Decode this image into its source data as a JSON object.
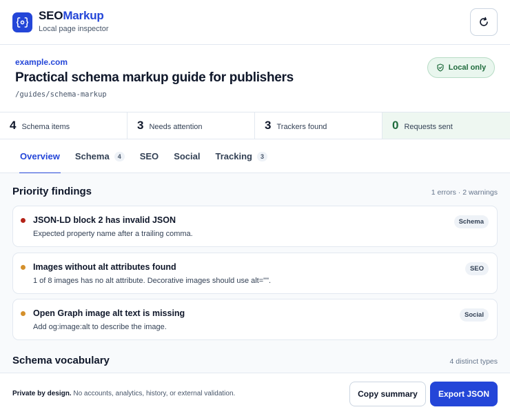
{
  "app": {
    "name_prefix": "SEO",
    "name_accent": "Markup",
    "subtitle": "Local page inspector",
    "brand_color": "#2446d8"
  },
  "header": {
    "refresh_icon": "refresh-icon"
  },
  "page": {
    "domain": "example.com",
    "title": "Practical schema markup guide for publishers",
    "path": "/guides/schema-markup",
    "local_badge": "Local only"
  },
  "stats": [
    {
      "value": "4",
      "label": "Schema items"
    },
    {
      "value": "3",
      "label": "Needs attention"
    },
    {
      "value": "3",
      "label": "Trackers found"
    },
    {
      "value": "0",
      "label": "Requests sent"
    }
  ],
  "tabs": [
    {
      "label": "Overview",
      "count": "",
      "active": true
    },
    {
      "label": "Schema",
      "count": "4"
    },
    {
      "label": "SEO",
      "count": ""
    },
    {
      "label": "Social",
      "count": ""
    },
    {
      "label": "Tracking",
      "count": "3"
    }
  ],
  "findings_section": {
    "title": "Priority findings",
    "meta": "1 errors · 2 warnings"
  },
  "findings": [
    {
      "severity": "error",
      "color": "#b42318",
      "title": "JSON-LD block 2 has invalid JSON",
      "description": "Expected property name after a trailing comma.",
      "tag": "Schema"
    },
    {
      "severity": "warning",
      "color": "#d4902c",
      "title": "Images without alt attributes found",
      "description": "1 of 8 images has no alt attribute. Decorative images should use alt=\"\".",
      "tag": "SEO"
    },
    {
      "severity": "warning",
      "color": "#d4902c",
      "title": "Open Graph image alt text is missing",
      "description": "Add og:image:alt to describe the image.",
      "tag": "Social"
    }
  ],
  "vocab_section": {
    "title": "Schema vocabulary",
    "meta": "4 distinct types"
  },
  "footer": {
    "privacy_bold": "Private by design.",
    "privacy_text": "No accounts, analytics, history, or external validation.",
    "copy_label": "Copy summary",
    "export_label": "Export JSON"
  }
}
